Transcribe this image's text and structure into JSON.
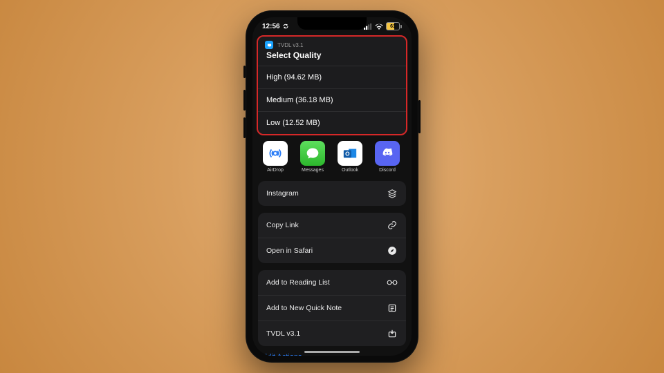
{
  "statusbar": {
    "time": "12:56",
    "battery_level": "61"
  },
  "panel": {
    "app_name": "TVDL v3.1",
    "title": "Select Quality",
    "options": [
      "High (94.62 MB)",
      "Medium (36.18 MB)",
      "Low (12.52 MB)"
    ]
  },
  "apps": {
    "airdrop": "AirDrop",
    "messages": "Messages",
    "outlook": "Outlook",
    "discord": "Discord"
  },
  "actions": {
    "instagram": "Instagram",
    "copy_link": "Copy Link",
    "open_safari": "Open in Safari",
    "reading_list": "Add to Reading List",
    "quick_note": "Add to New Quick Note",
    "tvdl": "TVDL v3.1",
    "edit": "Edit Actions..."
  }
}
